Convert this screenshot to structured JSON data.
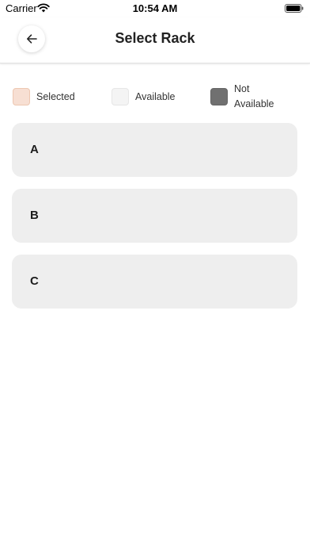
{
  "status_bar": {
    "carrier": "Carrier",
    "time": "10:54 AM"
  },
  "header": {
    "title": "Select Rack",
    "back_icon": "arrow-left-icon"
  },
  "legend": [
    {
      "label": "Selected",
      "color": "#f7dfd3"
    },
    {
      "label": "Available",
      "color": "#f4f4f4"
    },
    {
      "label": "Not Available",
      "color": "#707070"
    }
  ],
  "racks": [
    {
      "label": "A"
    },
    {
      "label": "B"
    },
    {
      "label": "C"
    }
  ],
  "colors": {
    "card_background": "#eeeeee",
    "text": "#222222"
  }
}
